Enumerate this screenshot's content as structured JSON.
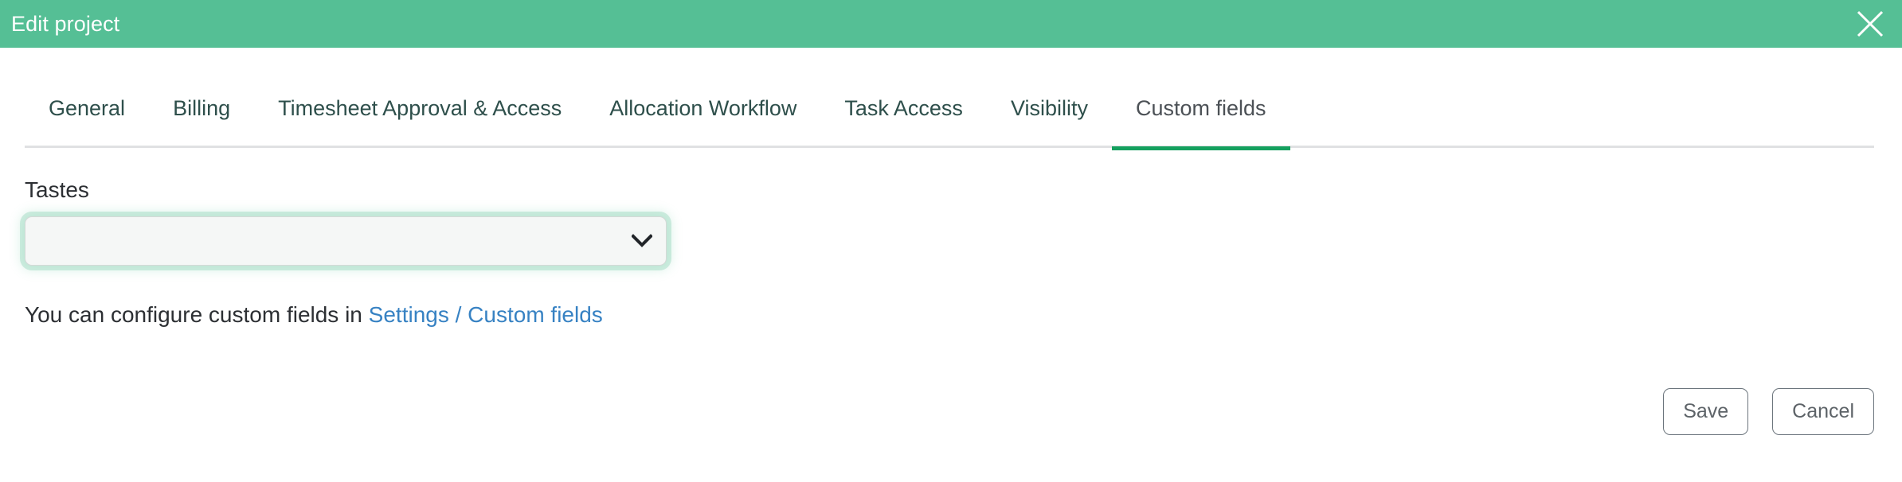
{
  "header": {
    "title": "Edit project",
    "background_color": "#55bf95",
    "title_color": "#ffffff",
    "close_icon": "close-icon"
  },
  "tabs": {
    "active_index": 6,
    "active_underline_color": "#14a05e",
    "items": [
      {
        "label": "General"
      },
      {
        "label": "Billing"
      },
      {
        "label": "Timesheet Approval & Access"
      },
      {
        "label": "Allocation Workflow"
      },
      {
        "label": "Task Access"
      },
      {
        "label": "Visibility"
      },
      {
        "label": "Custom fields"
      }
    ]
  },
  "custom_fields": {
    "field_label": "Tastes",
    "select": {
      "value": "",
      "placeholder": "",
      "chevron_icon": "chevron-down-icon",
      "focused": true,
      "focus_ring_color": "#67c79e",
      "options": [
        ""
      ]
    },
    "helper": {
      "prefix": "You can configure custom fields in ",
      "link_text": "Settings / Custom fields",
      "link_color": "#3782c3"
    }
  },
  "footer": {
    "save_label": "Save",
    "cancel_label": "Cancel"
  }
}
